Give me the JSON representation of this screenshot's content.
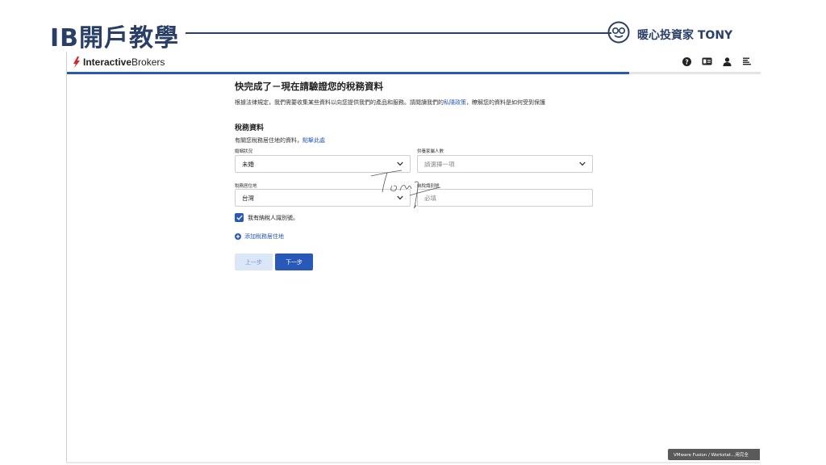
{
  "slide": {
    "title": "IB開戶教學",
    "brand_name": "暖心投資家 TONY",
    "accent_color": "#2a3f68"
  },
  "browser": {
    "logo_text_bold": "Interactive",
    "logo_text_regular": "Brokers",
    "header_icons": [
      "help-icon",
      "id-card-icon",
      "user-icon",
      "menu-icon"
    ],
    "progress_fraction": 0.81
  },
  "form": {
    "title": "快完成了－現在請驗證您的稅務資料",
    "description_prefix": "根據法律規定，我們需要收集某些資料以向您提供我們的產品和服務。請閱讀我們的",
    "privacy_link": "私隱政策",
    "description_suffix": "，瞭解您的資料是如何受到保護",
    "section_title": "稅務資料",
    "section_sub_prefix": "有關您稅務居住地的資料，",
    "section_sub_link": "點擊此處",
    "fields": {
      "marital_status": {
        "label": "婚姻狀況",
        "value": "未婚"
      },
      "dependents": {
        "label": "供養家屬人數",
        "placeholder": "請選擇一項"
      },
      "tax_residence": {
        "label": "稅務居住地",
        "value": "台灣"
      },
      "tax_id": {
        "label": "納稅識別號",
        "placeholder": "必填"
      }
    },
    "checkbox_label": "我有納稅人識別號。",
    "checkbox_checked": true,
    "add_residence_label": "添加稅務居住地",
    "back_button": "上一步",
    "next_button": "下一步",
    "primary_color": "#2858b8"
  },
  "system": {
    "tooltip": "VMware Fusion / Workstat...用完全"
  }
}
